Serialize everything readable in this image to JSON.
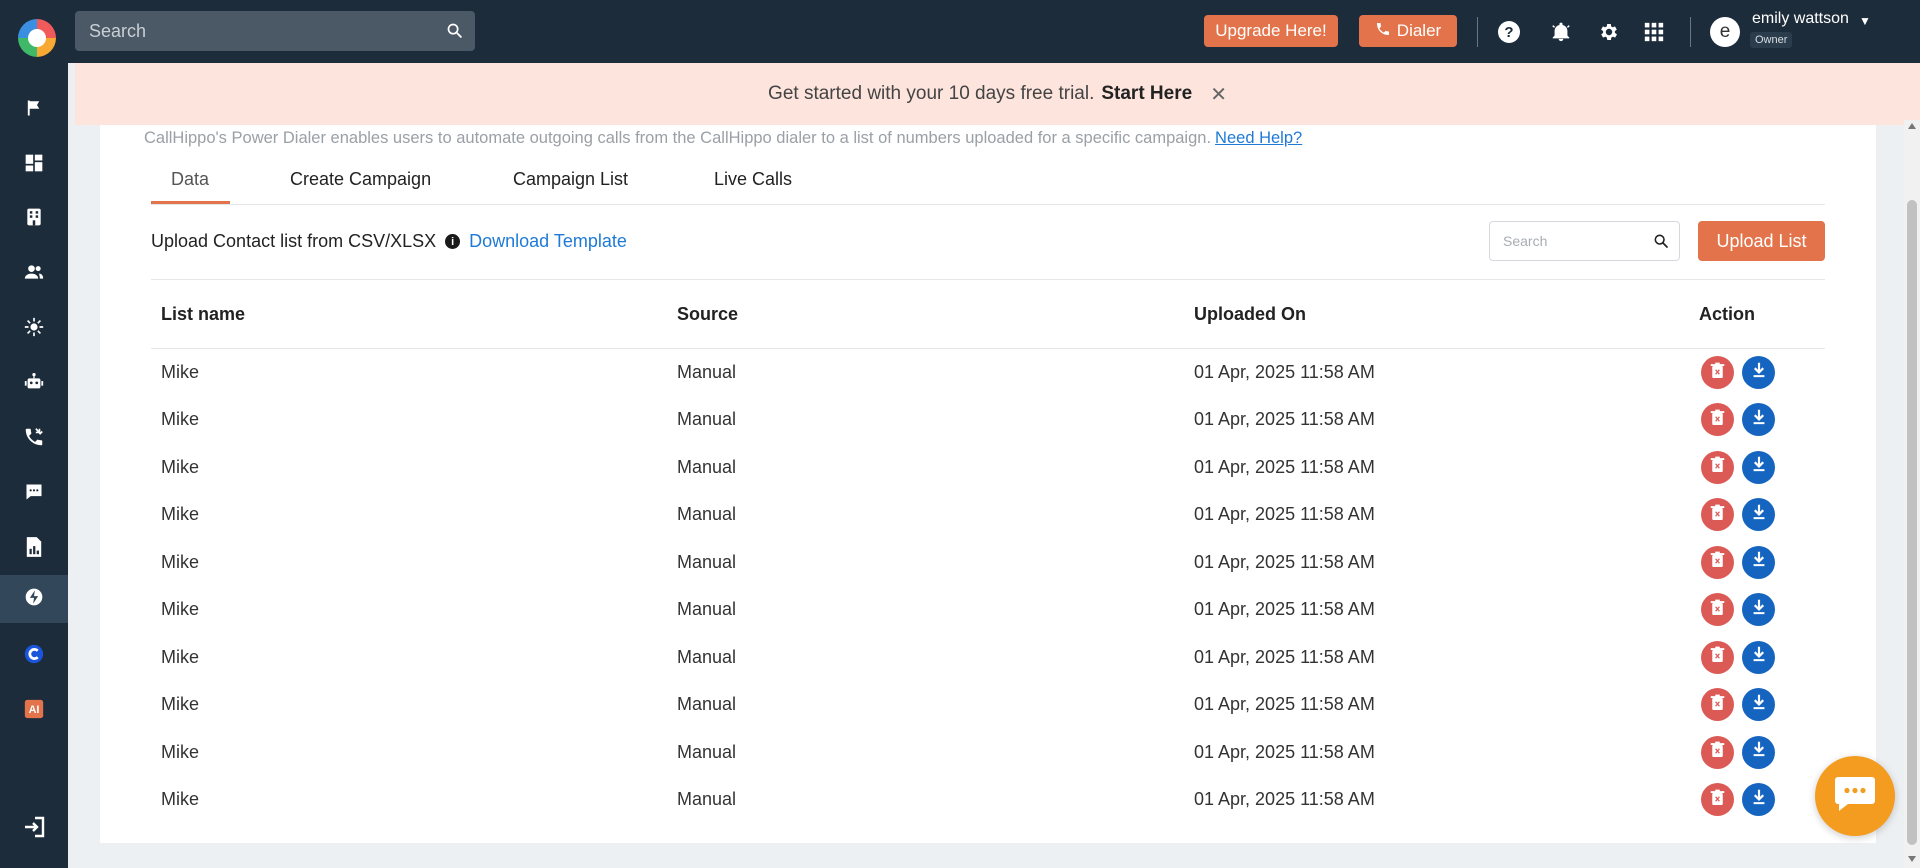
{
  "topbar": {
    "search_placeholder": "Search",
    "upgrade_label": "Upgrade Here!",
    "dialer_label": "Dialer",
    "user_initial": "e",
    "user_name": "emily wattson",
    "user_role": "Owner"
  },
  "sidebar": {
    "items": [
      {
        "icon": "flag-icon"
      },
      {
        "icon": "dashboard-icon"
      },
      {
        "icon": "building-icon"
      },
      {
        "icon": "users-icon"
      },
      {
        "icon": "integrations-icon"
      },
      {
        "icon": "robot-icon"
      },
      {
        "icon": "call-transfer-icon"
      },
      {
        "icon": "chat-icon"
      },
      {
        "icon": "reports-icon"
      },
      {
        "icon": "power-dialer-icon"
      },
      {
        "icon": "callhippo-icon"
      },
      {
        "icon": "ai-icon",
        "label": "AI"
      },
      {
        "icon": "logout-icon"
      }
    ],
    "active_index": 9
  },
  "trial_banner": {
    "text": "Get started with your 10 days free trial.",
    "cta": "Start Here",
    "close": "✕"
  },
  "page": {
    "description": "CallHippo's Power Dialer enables users to automate outgoing calls from the CallHippo dialer to a list of numbers uploaded for a specific campaign.",
    "help_link": "Need Help?",
    "tabs": [
      "Data",
      "Create Campaign",
      "Campaign List",
      "Live Calls"
    ],
    "active_tab": "Data",
    "upload_label": "Upload Contact list from CSV/XLSX",
    "download_template": "Download Template",
    "table_search_placeholder": "Search",
    "upload_button": "Upload List"
  },
  "table": {
    "headers": [
      "List name",
      "Source",
      "Uploaded On",
      "Action"
    ],
    "rows": [
      {
        "name": "Mike",
        "source": "Manual",
        "uploaded": "01 Apr, 2025 11:58 AM"
      },
      {
        "name": "Mike",
        "source": "Manual",
        "uploaded": "01 Apr, 2025 11:58 AM"
      },
      {
        "name": "Mike",
        "source": "Manual",
        "uploaded": "01 Apr, 2025 11:58 AM"
      },
      {
        "name": "Mike",
        "source": "Manual",
        "uploaded": "01 Apr, 2025 11:58 AM"
      },
      {
        "name": "Mike",
        "source": "Manual",
        "uploaded": "01 Apr, 2025 11:58 AM"
      },
      {
        "name": "Mike",
        "source": "Manual",
        "uploaded": "01 Apr, 2025 11:58 AM"
      },
      {
        "name": "Mike",
        "source": "Manual",
        "uploaded": "01 Apr, 2025 11:58 AM"
      },
      {
        "name": "Mike",
        "source": "Manual",
        "uploaded": "01 Apr, 2025 11:58 AM"
      },
      {
        "name": "Mike",
        "source": "Manual",
        "uploaded": "01 Apr, 2025 11:58 AM"
      },
      {
        "name": "Mike",
        "source": "Manual",
        "uploaded": "01 Apr, 2025 11:58 AM"
      }
    ]
  },
  "colors": {
    "topbar": "#1d2c3b",
    "accent": "#e2734b",
    "link": "#1f7ad6",
    "delete": "#dc5a55",
    "download": "#1565c0",
    "trial_bg": "#fde5de",
    "chat": "#f39c1f"
  }
}
